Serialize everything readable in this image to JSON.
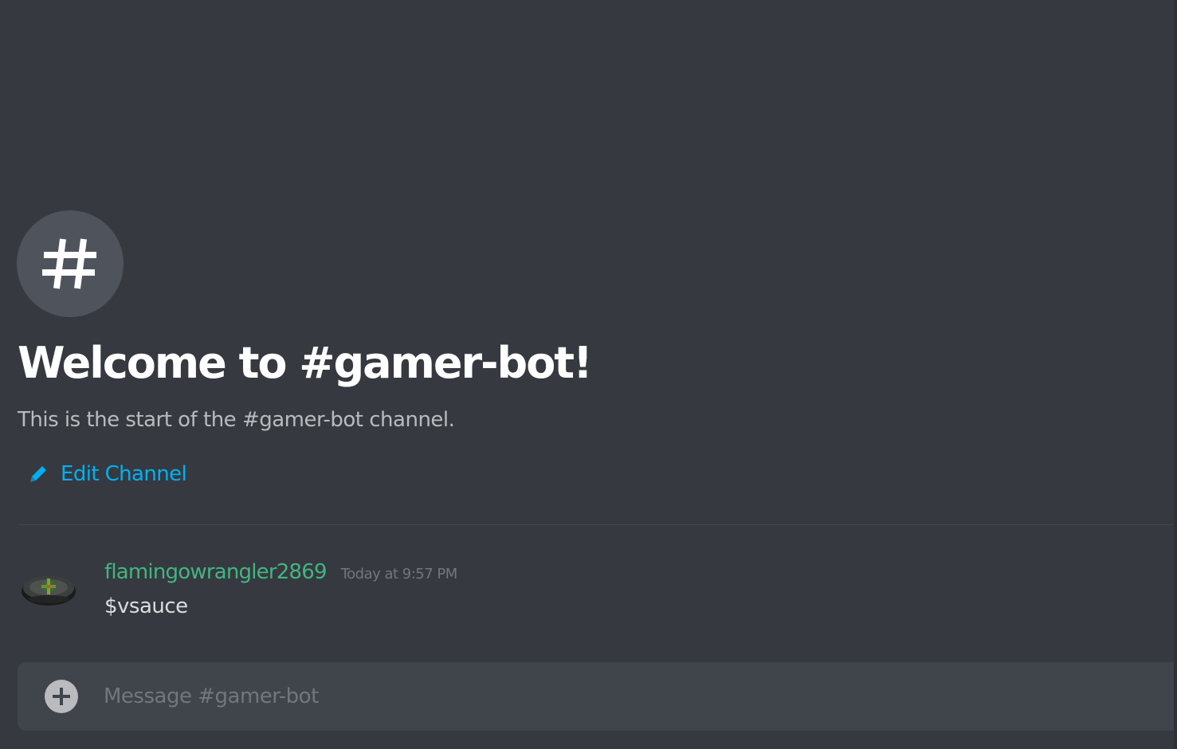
{
  "channel": {
    "icon": "hashtag-icon",
    "welcome_title": "Welcome to #gamer-bot!",
    "welcome_subtitle": "This is the start of the #gamer-bot channel.",
    "edit_label": "Edit Channel",
    "edit_icon": "pencil-icon"
  },
  "messages": [
    {
      "username": "flamingowrangler2869",
      "timestamp": "Today at 9:57 PM",
      "content": "$vsauce",
      "avatar": "avatar-image"
    }
  ],
  "composer": {
    "placeholder": "Message #gamer-bot",
    "value": "",
    "attach_icon": "plus-circle-icon"
  },
  "colors": {
    "background": "#36393f",
    "link": "#00b0f4",
    "username": "#43b581",
    "muted": "#72767d",
    "composer": "#40444b"
  }
}
